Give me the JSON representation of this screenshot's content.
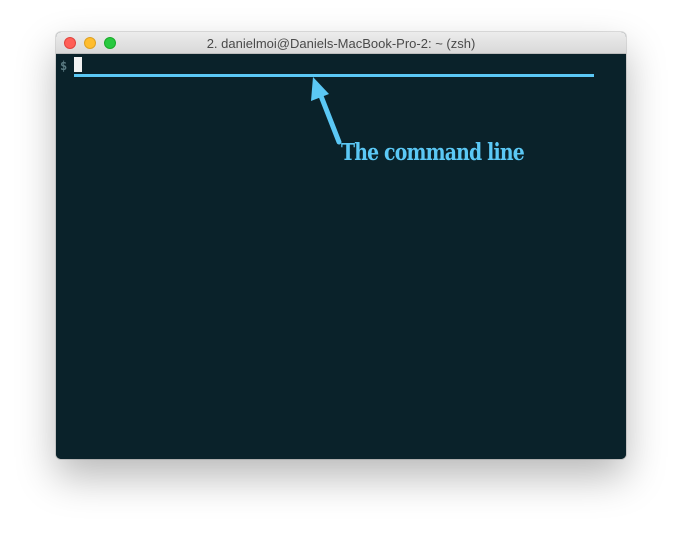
{
  "window": {
    "title": "2. danielmoi@Daniels-MacBook-Pro-2: ~ (zsh)",
    "traffic_lights": {
      "close_color": "#ff5f57",
      "minimize_color": "#ffbd2e",
      "zoom_color": "#28c940"
    }
  },
  "terminal": {
    "prompt": "$",
    "input_value": "",
    "background_color": "#0a222a",
    "cursor_color": "#f2f2f2"
  },
  "annotation": {
    "label": "The command line",
    "color": "#5bc8f5"
  }
}
